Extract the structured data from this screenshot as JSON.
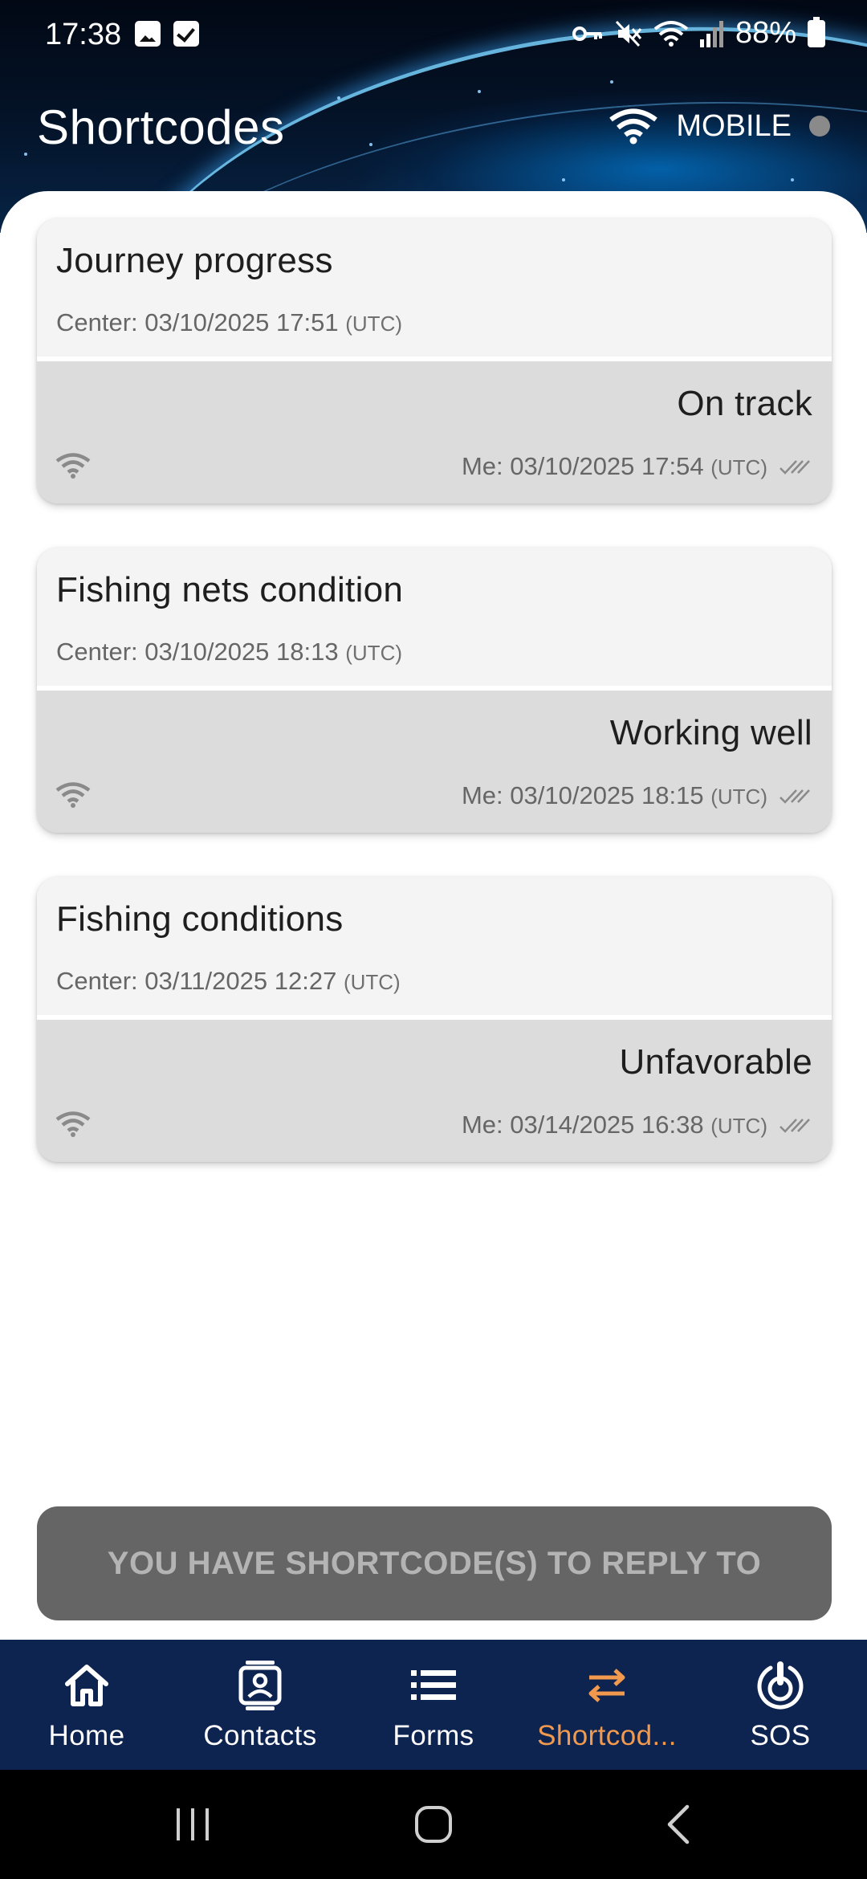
{
  "status_bar": {
    "time": "17:38",
    "battery": "88%",
    "icons": [
      "gallery-icon",
      "checkbox-icon",
      "key-icon",
      "mute-icon",
      "wifi-icon",
      "signal-icon",
      "battery-icon"
    ]
  },
  "header": {
    "title": "Shortcodes",
    "connection_label": "MOBILE",
    "connection_icon": "wifi-icon",
    "connection_dot_color": "#8a8a8a"
  },
  "cards": [
    {
      "title": "Journey progress",
      "center_prefix": "Center: 03/10/2025 17:51",
      "center_tz": "(UTC)",
      "reply": "On track",
      "me_prefix": "Me: 03/10/2025 17:54",
      "me_tz": "(UTC)"
    },
    {
      "title": "Fishing nets condition",
      "center_prefix": "Center: 03/10/2025 18:13",
      "center_tz": "(UTC)",
      "reply": "Working well",
      "me_prefix": "Me: 03/10/2025 18:15",
      "me_tz": "(UTC)"
    },
    {
      "title": "Fishing conditions",
      "center_prefix": "Center: 03/11/2025 12:27",
      "center_tz": "(UTC)",
      "reply": "Unfavorable",
      "me_prefix": "Me: 03/14/2025 16:38",
      "me_tz": "(UTC)"
    }
  ],
  "reply_banner": "YOU HAVE SHORTCODE(S) TO REPLY TO",
  "bottom_nav": {
    "items": [
      {
        "label": "Home",
        "icon": "home-icon"
      },
      {
        "label": "Contacts",
        "icon": "contacts-icon"
      },
      {
        "label": "Forms",
        "icon": "list-icon"
      },
      {
        "label": "Shortcod...",
        "icon": "swap-arrows-icon",
        "active": true
      },
      {
        "label": "SOS",
        "icon": "sos-icon"
      }
    ],
    "background": "#0d2350",
    "active_color": "#f19a4e"
  },
  "system_nav": [
    "recents-icon",
    "home-circle-icon",
    "back-icon"
  ]
}
